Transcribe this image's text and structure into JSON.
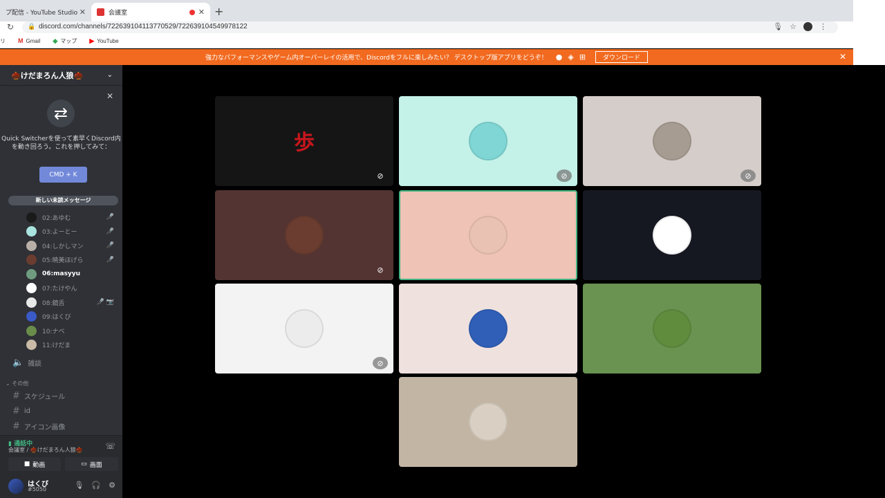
{
  "browser": {
    "tab1_title": "プ配信 - YouTube Studio",
    "tab2_title": "会議室",
    "url": "discord.com/channels/722639104113770529/722639104549978122",
    "bookmarks": [
      {
        "icon": "apps-icon",
        "label": "リ"
      },
      {
        "icon": "gmail-icon",
        "label": "Gmail"
      },
      {
        "icon": "maps-icon",
        "label": "マップ"
      },
      {
        "icon": "youtube-icon",
        "label": "YouTube"
      }
    ]
  },
  "banner": {
    "text": "強力なパフォーマンスやゲーム内オーバーレイの活用で、Discordをフルに楽しみたい？ デスクトップ版アプリをどうぞ！",
    "download_label": "ダウンロード"
  },
  "sidebar": {
    "guild_name": "🌰けだまろん人狼🌰",
    "quick_switcher_text": "Quick Switcherを使って素早くDiscord内を動き回ろう。これを押してみて：",
    "quick_switcher_button": "CMD + K",
    "new_unread": "新しい未読メッセージ",
    "voice_users": [
      {
        "name": "02:あゆむ",
        "color": "#1a1a1a",
        "status": "🎤̸",
        "active": false
      },
      {
        "name": "03:よーとー",
        "color": "#a9e3e0",
        "status": "🎤̸",
        "active": false
      },
      {
        "name": "04:しかしマン",
        "color": "#b8b0a8",
        "status": "🎤̸",
        "active": false
      },
      {
        "name": "05:暁美ほげら",
        "color": "#6b3d30",
        "status": "🎤̸",
        "active": false
      },
      {
        "name": "06:masyyu",
        "color": "#6f9c80",
        "status": "",
        "active": true
      },
      {
        "name": "07:たけやん",
        "color": "#ffffff",
        "status": "",
        "active": false
      },
      {
        "name": "08:鏡舌",
        "color": "#e8e8e8",
        "status": "🎤̸ 📷̸",
        "active": false
      },
      {
        "name": "09:はくび",
        "color": "#3a5bc7",
        "status": "",
        "active": false
      },
      {
        "name": "10:ナベ",
        "color": "#6a8c4a",
        "status": "",
        "active": false
      },
      {
        "name": "11:けだま",
        "color": "#c9bba7",
        "status": "",
        "active": false
      }
    ],
    "voice_channel_2": "雑談",
    "category": "その他",
    "text_channels": [
      "スケジュール",
      "id",
      "アイコン画像"
    ],
    "voice_status": "通話中",
    "voice_location": "会議室 / 🌰けだまろん人狼🌰",
    "video_button": "動画",
    "screen_button": "画面",
    "username": "はくび",
    "discriminator": "#5050"
  },
  "grid": {
    "tiles": [
      {
        "name": "02:あゆむ",
        "bg": "#151515",
        "avatar": "#151515",
        "kanji": "歩",
        "muted": true,
        "mute_style": "plain"
      },
      {
        "name": "03:よーとー",
        "bg": "#c4f1e8",
        "avatar": "#7fd6d4",
        "muted": true,
        "mute_style": "circle"
      },
      {
        "name": "04:しかしマン",
        "bg": "#d4cdca",
        "avatar": "#a69c92",
        "muted": true,
        "mute_style": "circle"
      },
      {
        "name": "05:暁美ほげら",
        "bg": "#533432",
        "avatar": "#6b3d30",
        "muted": true,
        "mute_style": "plain"
      },
      {
        "name": "06:masyyu",
        "bg": "#efc3b6",
        "avatar": "#eac2b4",
        "muted": false,
        "speaking": true
      },
      {
        "name": "07:たけやん",
        "bg": "#151821",
        "avatar": "#ffffff",
        "muted": false
      },
      {
        "name": "08:鏡舌",
        "bg": "#f3f3f3",
        "avatar": "#ececec",
        "muted": true,
        "mute_style": "circle"
      },
      {
        "name": "09:はくび",
        "bg": "#efe1de",
        "avatar": "#2f5fb7",
        "muted": false
      },
      {
        "name": "10:ナベ",
        "bg": "#6a9352",
        "avatar": "#5f8c3d",
        "muted": false
      },
      {
        "name": "11:けだま",
        "bg": "#c3b5a3",
        "avatar": "#d9d0c3",
        "muted": false
      }
    ]
  },
  "colors": {
    "accent": "#7289da",
    "voice_green": "#43b581",
    "banner": "#f26a1f"
  }
}
